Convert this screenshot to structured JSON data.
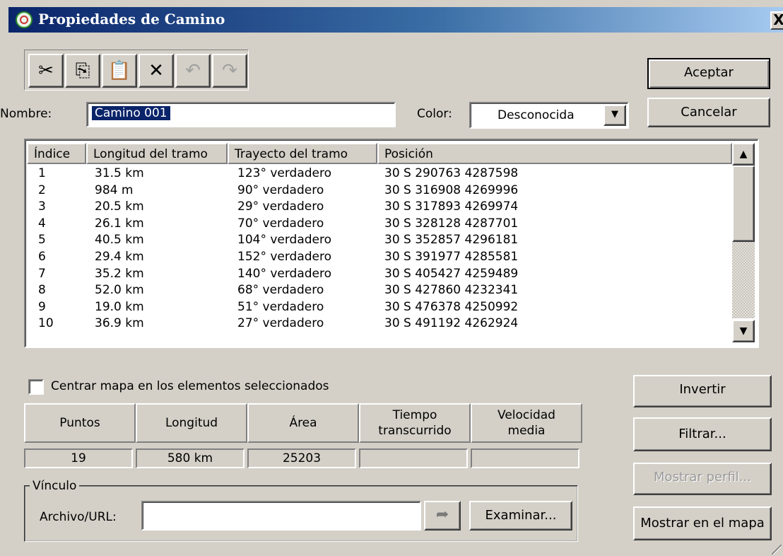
{
  "window": {
    "title": "Propiedades de Camino",
    "close_label": "X"
  },
  "toolbar": {
    "buttons": [
      {
        "icon": "scissors-icon",
        "glyph": "✂",
        "enabled": true
      },
      {
        "icon": "copy-icon",
        "glyph": "⎘",
        "enabled": true
      },
      {
        "icon": "paste-icon",
        "glyph": "📋",
        "enabled": true
      },
      {
        "icon": "delete-icon",
        "glyph": "✕",
        "enabled": true
      },
      {
        "icon": "undo-icon",
        "glyph": "↶",
        "enabled": false
      },
      {
        "icon": "redo-icon",
        "glyph": "↷",
        "enabled": false
      }
    ]
  },
  "form": {
    "name_label": "Nombre:",
    "name_value": "Camino 001",
    "color_label": "Color:",
    "color_value": "Desconocida"
  },
  "actions": {
    "accept": "Aceptar",
    "cancel": "Cancelar"
  },
  "list": {
    "headers": [
      "Índice",
      "Longitud del tramo",
      "Trayecto del tramo",
      "Posición"
    ],
    "rows": [
      [
        "1",
        "31.5 km",
        "123° verdadero",
        "30 S 290763 4287598"
      ],
      [
        "2",
        "984 m",
        "90° verdadero",
        "30 S 316908 4269996"
      ],
      [
        "3",
        "20.5 km",
        "29° verdadero",
        "30 S 317893 4269974"
      ],
      [
        "4",
        "26.1 km",
        "70° verdadero",
        "30 S 328128 4287701"
      ],
      [
        "5",
        "40.5 km",
        "104° verdadero",
        "30 S 352857 4296181"
      ],
      [
        "6",
        "29.4 km",
        "152° verdadero",
        "30 S 391977 4285581"
      ],
      [
        "7",
        "35.2 km",
        "140° verdadero",
        "30 S 405427 4259489"
      ],
      [
        "8",
        "52.0 km",
        "68° verdadero",
        "30 S 427860 4232341"
      ],
      [
        "9",
        "19.0 km",
        "51° verdadero",
        "30 S 476378 4250992"
      ],
      [
        "10",
        "36.9 km",
        "27° verdadero",
        "30 S 491192 4262924"
      ]
    ]
  },
  "center_map": {
    "label": "Centrar mapa en los elementos seleccionados",
    "checked": false
  },
  "stats": {
    "headers": [
      "Puntos",
      "Longitud",
      "Área",
      "Tiempo\ntranscurrido",
      "Velocidad\nmedia"
    ],
    "values": [
      "19",
      "580 km",
      "25203",
      "",
      ""
    ]
  },
  "link": {
    "group_label": "Vínculo",
    "file_label": "Archivo/URL:",
    "file_value": "",
    "browse_label": "Examinar..."
  },
  "side_buttons": {
    "invert": "Invertir",
    "filter": "Filtrar...",
    "profile": "Mostrar perfil...",
    "show_map": "Mostrar en el mapa"
  }
}
